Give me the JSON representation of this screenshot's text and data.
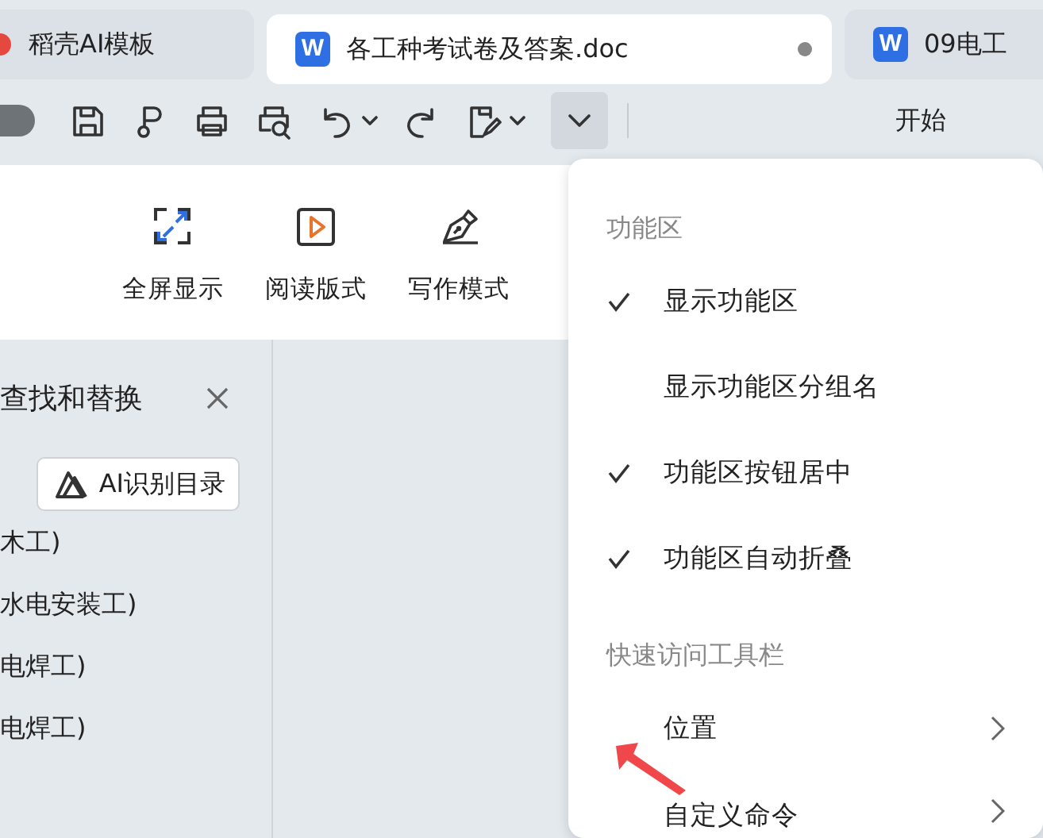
{
  "tabs": [
    {
      "label": "稻壳AI模板",
      "kind": "daoke",
      "selected": false,
      "modified": false
    },
    {
      "label": "各工种考试卷及答案.doc",
      "kind": "word",
      "icon_letter": "W",
      "selected": true,
      "modified": true
    },
    {
      "label": "09电工",
      "kind": "word",
      "icon_letter": "W",
      "selected": false,
      "modified": false
    }
  ],
  "toolbar": {
    "toggle_on": false,
    "customize_open": true,
    "ribbon_tab": "开始"
  },
  "ribbon": {
    "buttons": [
      {
        "label": "全屏显示",
        "kind": "fullscreen"
      },
      {
        "label": "阅读版式",
        "kind": "reading"
      },
      {
        "label": "写作模式",
        "kind": "writing"
      }
    ]
  },
  "find_pane": {
    "title": "查找和替换",
    "ai_button": "AI识别目录",
    "items": [
      "木工)",
      "水电安装工)",
      "电焊工)",
      "电焊工)"
    ]
  },
  "menu": {
    "sections": [
      {
        "header": "功能区",
        "items": [
          {
            "label": "显示功能区",
            "kind": "check",
            "checked": true
          },
          {
            "label": "显示功能区分组名",
            "kind": "check",
            "checked": false
          },
          {
            "label": "功能区按钮居中",
            "kind": "check",
            "checked": true
          },
          {
            "label": "功能区自动折叠",
            "kind": "check",
            "checked": true
          }
        ]
      },
      {
        "header": "快速访问工具栏",
        "items": [
          {
            "label": "位置",
            "kind": "submenu"
          },
          {
            "label": "自定义命令",
            "kind": "submenu"
          }
        ]
      }
    ]
  }
}
